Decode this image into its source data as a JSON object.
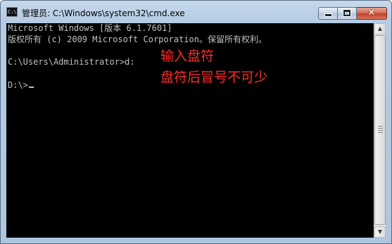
{
  "window": {
    "title": "管理员: C:\\Windows\\system32\\cmd.exe",
    "icon": "cmd-app-icon",
    "icon_text": "C:\\",
    "controls": {
      "minimize": "minimize-icon",
      "maximize": "maximize-icon",
      "close_glyph": "✕"
    }
  },
  "console": {
    "background": "#000000",
    "foreground": "#c0c0c0",
    "lines": [
      "Microsoft Windows [版本 6.1.7601]",
      "版权所有 (c) 2009 Microsoft Corporation。保留所有权利。",
      "",
      "C:\\Users\\Administrator>d:",
      "",
      "D:\\>"
    ]
  },
  "annotations": {
    "color": "#ff2a2a",
    "line1": "输入盘符",
    "line2": "盘符后冒号不可少"
  },
  "scrollbar": {
    "up_arrow": "▲",
    "down_arrow": "▼"
  }
}
